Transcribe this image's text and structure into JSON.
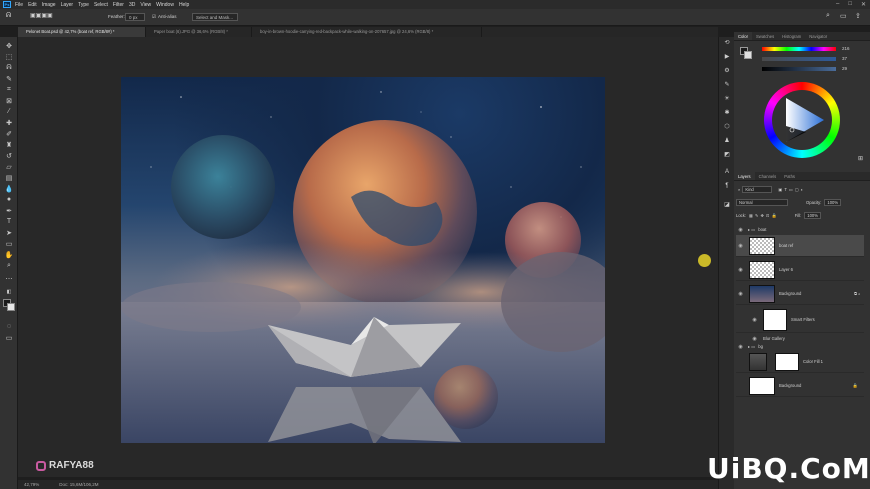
{
  "app": {
    "logo": "Ps"
  },
  "menu": [
    "File",
    "Edit",
    "Image",
    "Layer",
    "Type",
    "Select",
    "Filter",
    "3D",
    "View",
    "Window",
    "Help"
  ],
  "options": {
    "feather_label": "Feather:",
    "feather_value": "0 px",
    "antialias_label": "Anti-alias",
    "select_mask_label": "Select and Mask..."
  },
  "tabs": [
    "Pelonet Boat.psd @ 42,7% (boat ref, RGB/8#) *",
    "Paper boat (6).JPG @ 36,6% (RGB/8) *",
    "boy-in-brown-hoodie-carrying-red-backpack-while-walking-on-207657.jpg @ 24,6% (RGB/8) *"
  ],
  "status": {
    "zoom": "42,79%",
    "doc": "Doc: 15,6M/106,2M"
  },
  "color_panel": {
    "tabs": [
      "Color",
      "Swatches",
      "Histogram",
      "Navigator"
    ],
    "h_value": "216",
    "s_value": "37",
    "b_value": "29"
  },
  "layers_panel": {
    "tabs": [
      "Layers",
      "Channels",
      "Paths"
    ],
    "kind_label": "Kind",
    "blend_mode": "Normal",
    "opacity_label": "Opacity:",
    "opacity_value": "100%",
    "lock_label": "Lock:",
    "fill_label": "Fill:",
    "fill_value": "100%",
    "layers": [
      {
        "name": "boat"
      },
      {
        "name": "boat ref"
      },
      {
        "name": "Layer 6"
      },
      {
        "name": "Background"
      },
      {
        "name": "Smart Filters"
      },
      {
        "name": "Blur Gallery"
      },
      {
        "name": "bg"
      },
      {
        "name": "Color Fill 1"
      },
      {
        "name": "Background"
      }
    ]
  },
  "watermark": {
    "handle": "RAFYA88",
    "site": "UiBQ.CoM"
  },
  "colors": {
    "accent": "#31a8ff",
    "panel": "#323232",
    "work": "#282828"
  }
}
